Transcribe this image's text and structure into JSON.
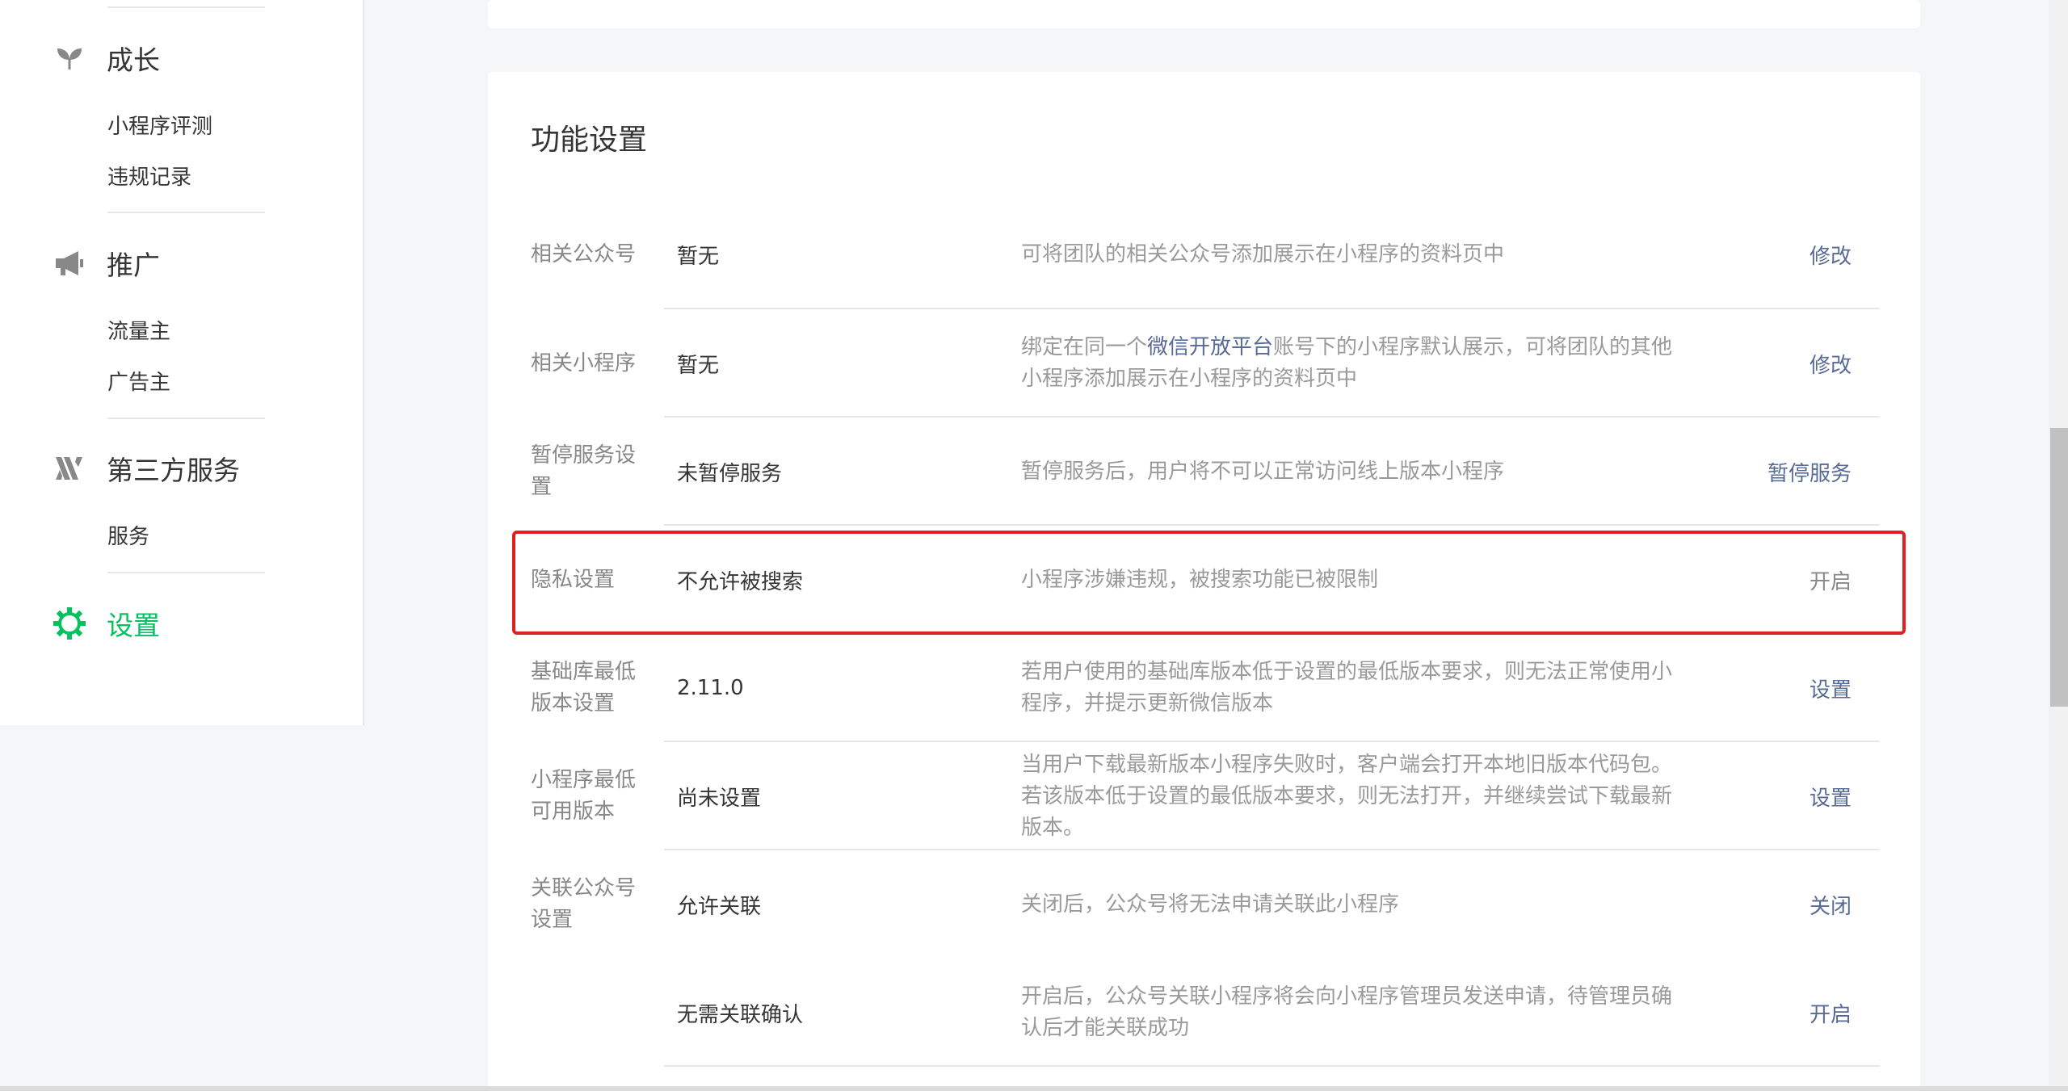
{
  "sidebar": {
    "sections": [
      {
        "title": "成长",
        "icon": "leaf-icon",
        "items": [
          "小程序评测",
          "违规记录"
        ]
      },
      {
        "title": "推广",
        "icon": "megaphone-icon",
        "items": [
          "流量主",
          "广告主"
        ]
      },
      {
        "title": "第三方服务",
        "icon": "third-party-icon",
        "items": [
          "服务"
        ]
      },
      {
        "title": "设置",
        "icon": "gear-icon",
        "items": [],
        "active": true
      }
    ]
  },
  "main": {
    "title": "功能设置",
    "rows": [
      {
        "label": "相关公众号",
        "value": "暂无",
        "description": "可将团队的相关公众号添加展示在小程序的资料页中",
        "action": "修改"
      },
      {
        "label": "相关小程序",
        "value": "暂无",
        "description_prefix": "绑定在同一个",
        "description_link": "微信开放平台",
        "description_suffix": "账号下的小程序默认展示，可将团队的其他小程序添加展示在小程序的资料页中",
        "action": "修改"
      },
      {
        "label": "暂停服务设置",
        "value": "未暂停服务",
        "description": "暂停服务后，用户将不可以正常访问线上版本小程序",
        "action": "暂停服务"
      },
      {
        "label": "隐私设置",
        "value": "不允许被搜索",
        "description": "小程序涉嫌违规，被搜索功能已被限制",
        "action": "开启",
        "action_disabled": true
      },
      {
        "label": "基础库最低版本设置",
        "value": "2.11.0",
        "description": "若用户使用的基础库版本低于设置的最低版本要求，则无法正常使用小程序，并提示更新微信版本",
        "action": "设置"
      },
      {
        "label": "小程序最低可用版本",
        "value": "尚未设置",
        "description": "当用户下载最新版本小程序失败时，客户端会打开本地旧版本代码包。若该版本低于设置的最低版本要求，则无法打开，并继续尝试下载最新版本。",
        "action": "设置"
      },
      {
        "label": "关联公众号设置",
        "value": "允许关联",
        "description": "关闭后，公众号将无法申请关联此小程序",
        "action": "关闭"
      },
      {
        "label": "",
        "value": "无需关联确认",
        "description": "开启后，公众号关联小程序将会向小程序管理员发送申请，待管理员确认后才能关联成功",
        "action": "开启"
      }
    ]
  },
  "colors": {
    "accent_green": "#07c160",
    "link_blue": "#576b95",
    "highlight_red": "#e02020"
  }
}
